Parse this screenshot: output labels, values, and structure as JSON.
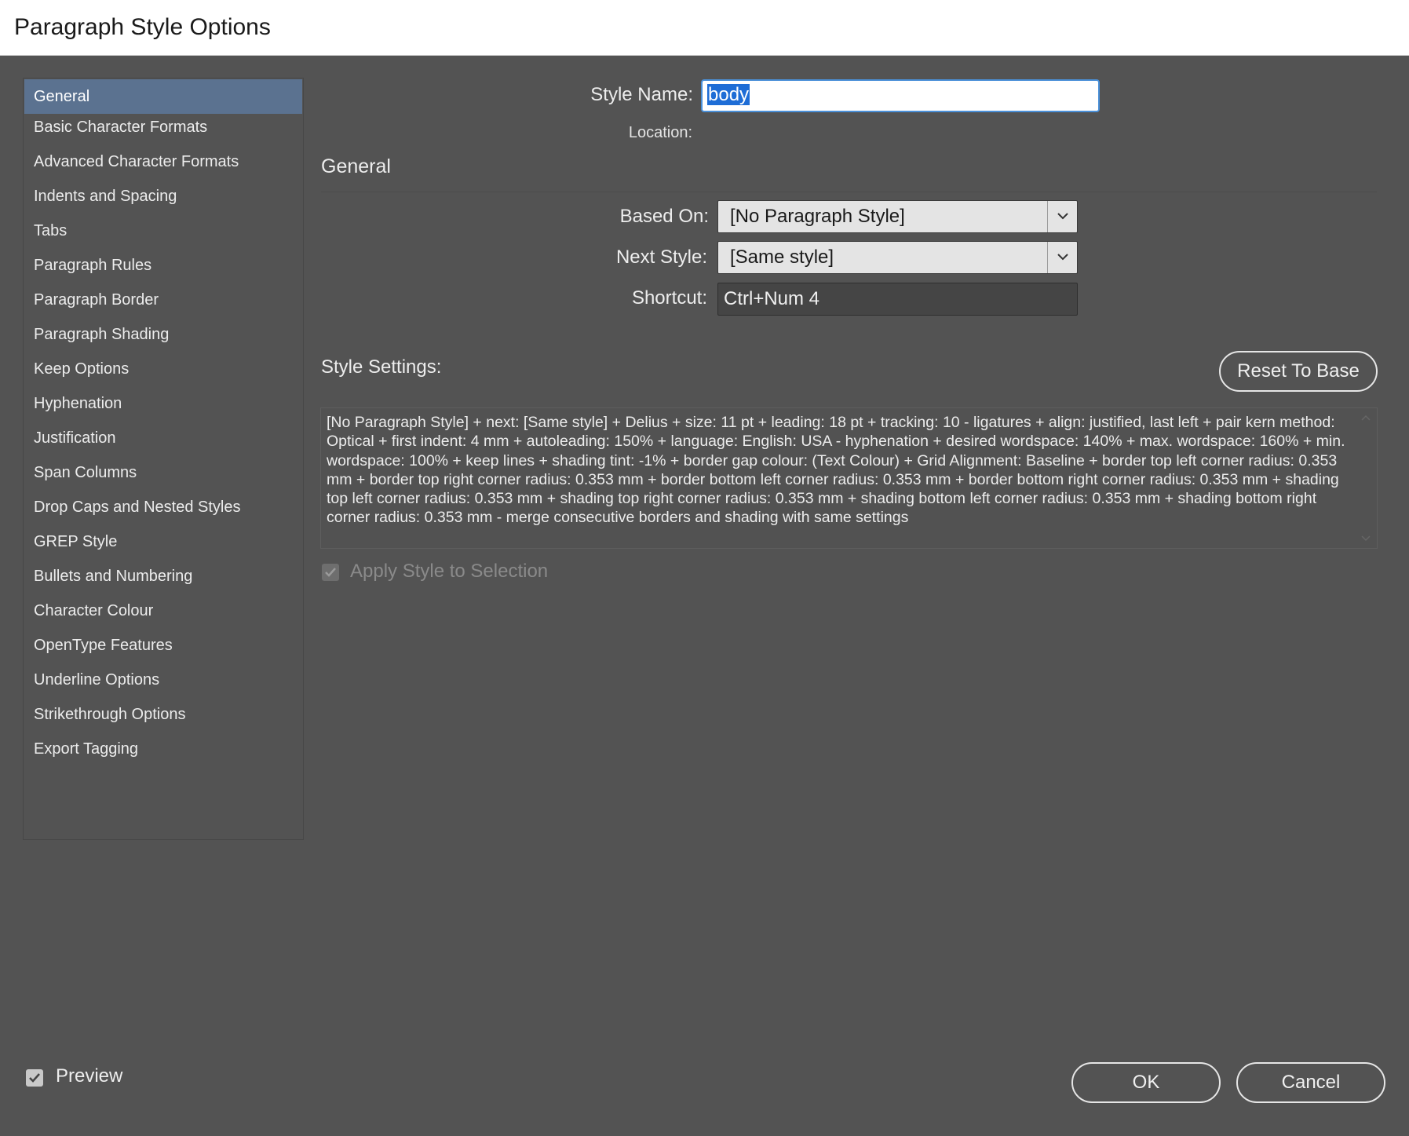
{
  "window": {
    "title": "Paragraph Style Options"
  },
  "sidebar": {
    "items": [
      {
        "label": "General",
        "selected": true
      },
      {
        "label": "Basic Character Formats"
      },
      {
        "label": "Advanced Character Formats"
      },
      {
        "label": "Indents and Spacing"
      },
      {
        "label": "Tabs"
      },
      {
        "label": "Paragraph Rules"
      },
      {
        "label": "Paragraph Border"
      },
      {
        "label": "Paragraph Shading"
      },
      {
        "label": "Keep Options"
      },
      {
        "label": "Hyphenation"
      },
      {
        "label": "Justification"
      },
      {
        "label": "Span Columns"
      },
      {
        "label": "Drop Caps and Nested Styles"
      },
      {
        "label": "GREP Style"
      },
      {
        "label": "Bullets and Numbering"
      },
      {
        "label": "Character Colour"
      },
      {
        "label": "OpenType Features"
      },
      {
        "label": "Underline Options"
      },
      {
        "label": "Strikethrough Options"
      },
      {
        "label": "Export Tagging"
      }
    ]
  },
  "form": {
    "style_name_label": "Style Name:",
    "style_name_value": "body",
    "location_label": "Location:",
    "section_title": "General",
    "based_on_label": "Based On:",
    "based_on_value": "[No Paragraph Style]",
    "next_style_label": "Next Style:",
    "next_style_value": "[Same style]",
    "shortcut_label": "Shortcut:",
    "shortcut_value": "Ctrl+Num 4",
    "style_settings_label": "Style Settings:",
    "reset_button": "Reset To Base",
    "style_settings_text": "[No Paragraph Style] + next: [Same style] + Delius + size: 11 pt + leading: 18 pt + tracking: 10 - ligatures + align: justified, last left + pair kern method: Optical + first indent: 4 mm + autoleading: 150% + language: English: USA - hyphenation + desired wordspace: 140% + max. wordspace: 160% + min. wordspace: 100% + keep lines + shading tint: -1% + border gap colour: (Text Colour) + Grid Alignment:  Baseline + border top left corner radius: 0.353 mm + border top right corner radius: 0.353 mm + border bottom left corner radius: 0.353 mm + border bottom right corner radius: 0.353 mm + shading top left corner radius: 0.353 mm + shading top right corner radius: 0.353 mm + shading bottom left corner radius: 0.353 mm + shading bottom right corner radius: 0.353 mm - merge consecutive borders and shading with same settings",
    "apply_style_label": "Apply Style to Selection",
    "apply_style_checked": true,
    "apply_style_enabled": false
  },
  "footer": {
    "preview_label": "Preview",
    "preview_checked": true,
    "ok_button": "OK",
    "cancel_button": "Cancel"
  },
  "colors": {
    "dialog_bg": "#535353",
    "selected_item_bg": "#5b7290",
    "focus_border": "#4a90d9",
    "text_selection": "#1e6dd6"
  },
  "icons": {
    "dropdown": "chevron-down-icon",
    "checkbox": "checkmark-icon"
  }
}
